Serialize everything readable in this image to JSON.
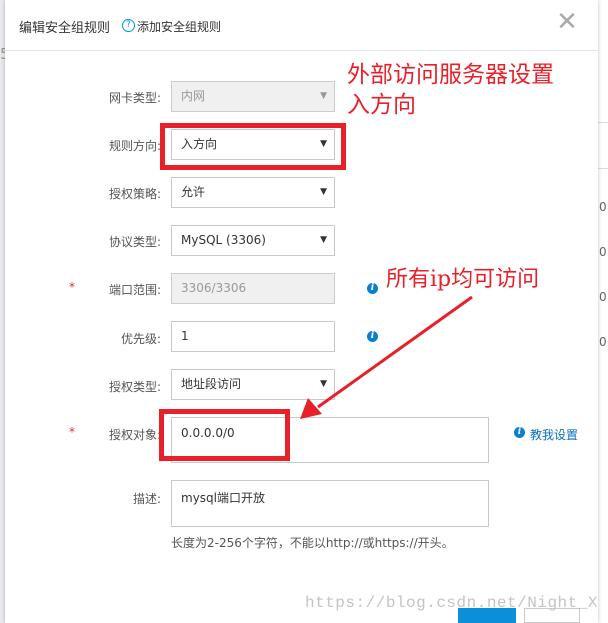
{
  "background": {
    "left_char": "5",
    "right_marks": [
      "0",
      "0",
      "0",
      "0"
    ]
  },
  "dialog": {
    "title": "编辑安全组规则",
    "help_icon_glyph": "?",
    "help_link": "添加安全组规则",
    "close_glyph": "✕"
  },
  "form": {
    "nic_type": {
      "label": "网卡类型:",
      "value": "内网"
    },
    "rule_direction": {
      "label": "规则方向:",
      "value": "入方向"
    },
    "auth_policy": {
      "label": "授权策略:",
      "value": "允许"
    },
    "protocol_type": {
      "label": "协议类型:",
      "value": "MySQL (3306)"
    },
    "port_range": {
      "label": "端口范围:",
      "value": "3306/3306",
      "required": "*"
    },
    "priority": {
      "label": "优先级:",
      "value": "1"
    },
    "auth_type": {
      "label": "授权类型:",
      "value": "地址段访问"
    },
    "auth_object": {
      "label": "授权对象:",
      "value": "0.0.0.0/0",
      "required": "*"
    },
    "tutorial_link": "教我设置",
    "description": {
      "label": "描述:",
      "value": "mysql端口开放"
    },
    "hint": "长度为2-256个字符，不能以http://或https://开头。"
  },
  "icons": {
    "info_glyph": "i",
    "caret_glyph": "▼"
  },
  "annotations": {
    "inbound_line1": "外部访问服务器设置",
    "inbound_line2": "入方向",
    "all_ip": "所有ip均可访问",
    "color": "#e8202a"
  },
  "watermark": "https://blog.csdn.net/Night_X",
  "colors": {
    "accent": "#0a7fd0",
    "primary_button": "#0a8fd8",
    "required": "#e0302f"
  }
}
